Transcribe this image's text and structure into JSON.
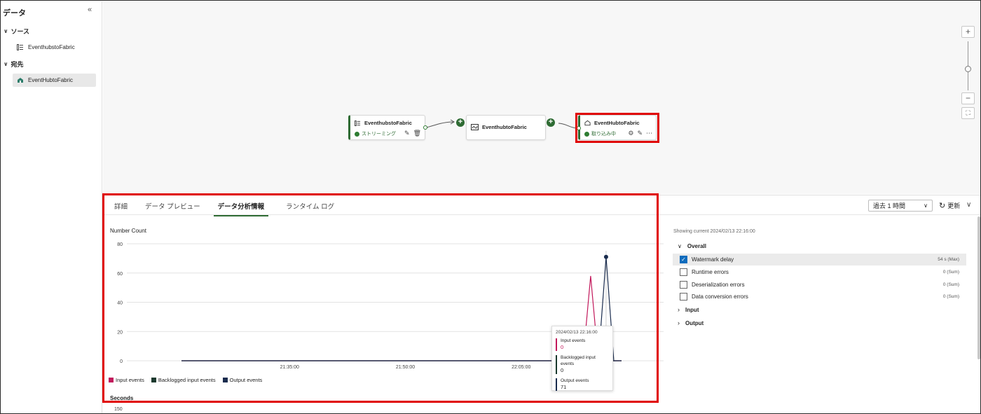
{
  "sidebar": {
    "title": "データ",
    "collapse_glyph": "«",
    "sections": [
      {
        "label": "ソース",
        "items": [
          {
            "label": "EventhubstoFabric",
            "icon": "eventhub-icon"
          }
        ]
      },
      {
        "label": "宛先",
        "items": [
          {
            "label": "EventHubtoFabric",
            "icon": "lakehouse-icon",
            "selected": true
          }
        ]
      }
    ]
  },
  "canvas": {
    "source_node": {
      "title": "EventhubstoFabric",
      "status": "ストリーミング"
    },
    "stream_node": {
      "title": "EventhubtoFabric"
    },
    "destination_node": {
      "title": "EventHubtoFabric",
      "status": "取り込み中"
    },
    "zoom": {
      "in": "+",
      "out": "−"
    }
  },
  "panel": {
    "tabs": [
      {
        "label": "詳細"
      },
      {
        "label": "データ プレビュー"
      },
      {
        "label": "データ分析情報",
        "active": true
      },
      {
        "label": "ランタイム ログ"
      }
    ],
    "time_range": "過去 1 時間",
    "refresh_label": "更新",
    "chart_title": "Number Count",
    "seconds_title": "Seconds",
    "seconds_first_tick": "150",
    "tooltip": {
      "time": "2024/02/13 22:16:00",
      "rows": [
        {
          "label": "Input events",
          "value": "0",
          "color": "#c2185b"
        },
        {
          "label": "Backlogged input events",
          "value": "0",
          "color": "#1b3a2e"
        },
        {
          "label": "Output events",
          "value": "71",
          "color": "#1a2c4e"
        }
      ]
    },
    "metrics": {
      "showing": "Showing current 2024/02/13 22:16:00",
      "overall_label": "Overall",
      "items": [
        {
          "label": "Watermark delay",
          "value": "54 s (Max)",
          "checked": true
        },
        {
          "label": "Runtime errors",
          "value": "0 (Sum)",
          "checked": false
        },
        {
          "label": "Deserialization errors",
          "value": "0 (Sum)",
          "checked": false
        },
        {
          "label": "Data conversion errors",
          "value": "0 (Sum)",
          "checked": false
        }
      ],
      "input_label": "Input",
      "output_label": "Output"
    }
  },
  "chart_data": {
    "type": "line",
    "title": "Number Count",
    "ylim": [
      0,
      80
    ],
    "yticks": [
      0,
      20,
      40,
      60,
      80
    ],
    "xticks": [
      "21:35:00",
      "21:50:00",
      "22:05:00"
    ],
    "legend_placement": "bottom-left",
    "grid": true,
    "series": [
      {
        "name": "Input events",
        "color": "#c2185b",
        "points": [
          [
            "21:21:00",
            0
          ],
          [
            "22:13:00",
            0
          ],
          [
            "22:14:00",
            58
          ],
          [
            "22:15:00",
            0
          ],
          [
            "22:16:00",
            0
          ],
          [
            "22:18:00",
            0
          ]
        ]
      },
      {
        "name": "Backlogged input events",
        "color": "#1b3a2e",
        "points": [
          [
            "21:21:00",
            0
          ],
          [
            "22:18:00",
            0
          ]
        ]
      },
      {
        "name": "Output events",
        "color": "#1a2c4e",
        "points": [
          [
            "21:21:00",
            0
          ],
          [
            "22:15:00",
            0
          ],
          [
            "22:16:00",
            71
          ],
          [
            "22:17:00",
            0
          ],
          [
            "22:18:00",
            0
          ]
        ]
      }
    ]
  }
}
